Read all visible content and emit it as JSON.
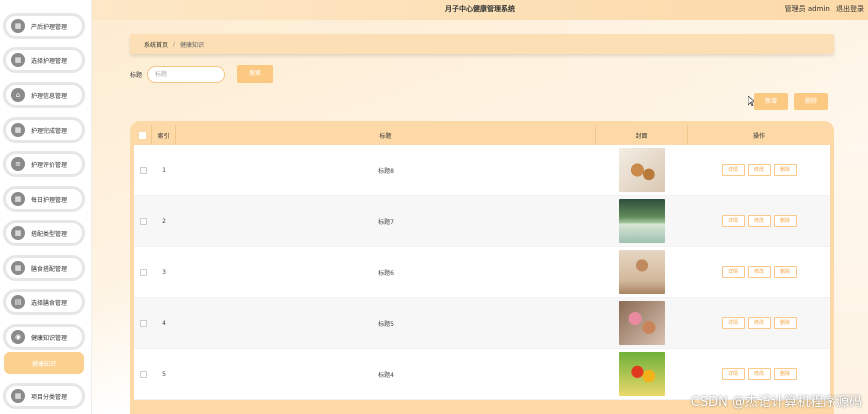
{
  "app": {
    "title": "月子中心健康管理系统",
    "user": "管理员 admin",
    "logout": "退出登录"
  },
  "colors": {
    "accent": "#fcc983",
    "header_bg": "#fcd9a7",
    "sidebar_active": "#fbd08f"
  },
  "sidebar": {
    "items": [
      {
        "label": "产后护理管理",
        "icon": "grid-icon"
      },
      {
        "label": "选择护理管理",
        "icon": "grid-icon"
      },
      {
        "label": "护理信息管理",
        "icon": "home-icon"
      },
      {
        "label": "护理完成管理",
        "icon": "grid-icon"
      },
      {
        "label": "护理评价管理",
        "icon": "list-icon"
      },
      {
        "label": "每日护理管理",
        "icon": "grid-icon"
      },
      {
        "label": "搭配类型管理",
        "icon": "grid-icon"
      },
      {
        "label": "膳食搭配管理",
        "icon": "grid-icon"
      },
      {
        "label": "选择膳食管理",
        "icon": "doc-icon"
      },
      {
        "label": "健康知识管理",
        "icon": "pin-icon"
      }
    ],
    "active_sub": "健康知识",
    "last_item": {
      "label": "项目分类管理",
      "icon": "grid-icon"
    }
  },
  "breadcrumb": {
    "home": "系统首页",
    "separator": "/",
    "current": "健康知识"
  },
  "search": {
    "label": "标题",
    "placeholder": "标题",
    "button": "搜索"
  },
  "actions": {
    "add": "新增",
    "delete": "删除"
  },
  "table": {
    "headers": {
      "index": "索引",
      "title": "标题",
      "image": "封面",
      "ops": "操作"
    },
    "row_ops": {
      "detail": "详情",
      "edit": "修改",
      "delete": "删除"
    },
    "rows": [
      {
        "index": "1",
        "title": "标题8",
        "image": "food-photo"
      },
      {
        "index": "2",
        "title": "标题7",
        "image": "lake-photo"
      },
      {
        "index": "3",
        "title": "标题6",
        "image": "fitness-photo"
      },
      {
        "index": "4",
        "title": "标题5",
        "image": "donut-photo"
      },
      {
        "index": "5",
        "title": "标题4",
        "image": "fruit-photo"
      }
    ]
  },
  "watermark": "CSDN @杰记计算机程序源码"
}
